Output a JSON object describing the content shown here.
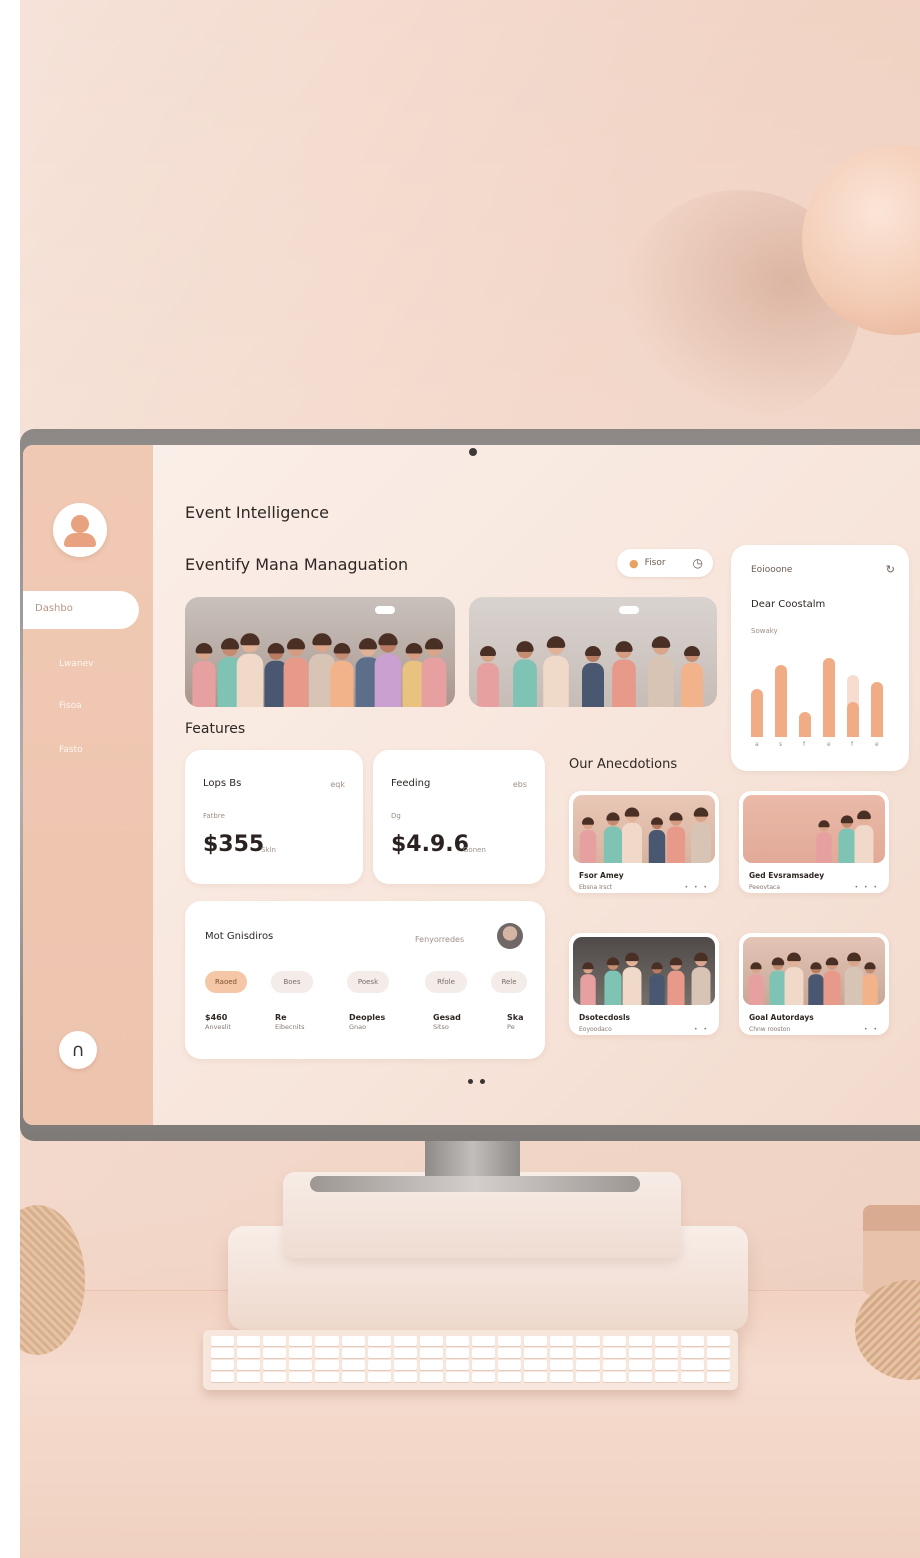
{
  "sidebar": {
    "active_item": "Dashbo",
    "items": [
      "Lwanev",
      "Fisoa",
      "Fasto"
    ],
    "home_glyph": "∩"
  },
  "header": {
    "app_title": "Event Intelligence",
    "page_title": "Eventify Mana Managuation",
    "filter_label": "Fisor"
  },
  "features": {
    "section_title": "Features",
    "cards": [
      {
        "label": "Lops Bs",
        "aux": "eqk",
        "sub": "Fatbre",
        "value": "$355",
        "unit": "Skln"
      },
      {
        "label": "Feeding",
        "aux": "ebs",
        "sub": "Dg",
        "value": "$4.9.6",
        "unit": "Gonen"
      }
    ]
  },
  "meet_card": {
    "title": "Mot Gnisdiros",
    "owner": "Fenyorredes",
    "chips": [
      "Raoed",
      "Boes",
      "Poesk",
      "Rfole",
      "Rele"
    ],
    "metrics": [
      {
        "value": "$460",
        "label": "Anveslit"
      },
      {
        "value": "Re",
        "label": "Eibecnits"
      },
      {
        "value": "Deoples",
        "label": "Gnao"
      },
      {
        "value": "Gesad",
        "label": "Sitso"
      },
      {
        "value": "Ska",
        "label": "Pe"
      }
    ]
  },
  "analytics": {
    "label": "Eoiooone",
    "heading": "Dear Coostalm",
    "small": "Sowaky",
    "bars": [
      0.55,
      0.82,
      0.28,
      0.9,
      0.7,
      0.62
    ],
    "bar_fill": [
      0.55,
      0.82,
      0.28,
      0.9,
      0.4,
      0.62
    ],
    "ticks": [
      "a",
      "s",
      "f",
      "e",
      "f",
      "e"
    ],
    "accent": "#f0ad85"
  },
  "anecdotes": {
    "section_title": "Our Anecdotions",
    "items": [
      {
        "title": "Fsor Amey",
        "sub": "Ebsna Irsct",
        "meta": "• • •"
      },
      {
        "title": "Ged Evsramsadey",
        "sub": "Peeovtaca",
        "meta": "• • •"
      },
      {
        "title": "Dsotecdosls",
        "sub": "Eoyoodaco",
        "meta": "• •"
      },
      {
        "title": "Goal Autordays",
        "sub": "Chnw rooston",
        "meta": "• •"
      }
    ]
  },
  "pager": {
    "pages": 2,
    "current": 1
  },
  "icons": {
    "avatar": "user-avatar-icon",
    "home": "home-icon",
    "filter_pin": "pin-icon",
    "filter_clock": "clock-icon",
    "analytics_more": "refresh-icon"
  }
}
